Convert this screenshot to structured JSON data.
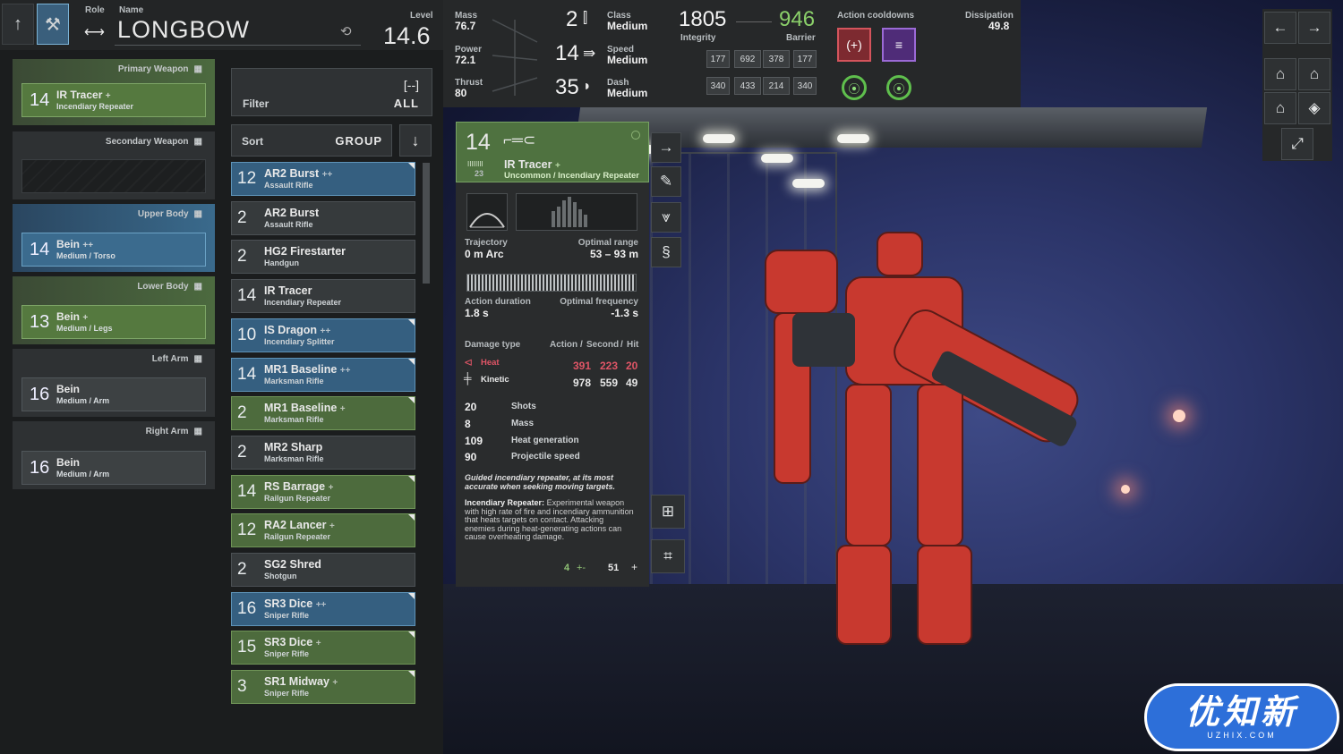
{
  "header": {
    "role_label": "Role",
    "name_label": "Name",
    "name": "LONGBOW",
    "level_label": "Level",
    "level": "14.6"
  },
  "stats": {
    "mass_label": "Mass",
    "mass": "76.7",
    "power_label": "Power",
    "power": "72.1",
    "thrust_label": "Thrust",
    "thrust": "80",
    "count1": "2",
    "count2": "14",
    "count3": "35",
    "class_label": "Class",
    "class_value": "Medium",
    "speed_label": "Speed",
    "speed_value": "Medium",
    "dash_label": "Dash",
    "dash_value": "Medium",
    "integrity": "1805",
    "integrity_label": "Integrity",
    "barrier": "946",
    "barrier_label": "Barrier",
    "cells_row1": [
      "177",
      "692",
      "378",
      "177"
    ],
    "cells_row2": [
      "340",
      "433",
      "214",
      "340"
    ],
    "cooldowns_label": "Action cooldowns",
    "dissipation_label": "Dissipation",
    "dissipation": "49.8"
  },
  "slots": [
    {
      "title": "Primary Weapon",
      "level": "14",
      "name": "IR Tracer",
      "plus": "+",
      "sub": "Incendiary Repeater",
      "color": "green"
    },
    {
      "title": "Secondary Weapon",
      "level": "",
      "name": "",
      "plus": "",
      "sub": "",
      "color": "empty"
    },
    {
      "title": "Upper Body",
      "level": "14",
      "name": "Bein",
      "plus": "++",
      "sub": "Medium / Torso",
      "color": "blue"
    },
    {
      "title": "Lower Body",
      "level": "13",
      "name": "Bein",
      "plus": "+",
      "sub": "Medium / Legs",
      "color": "green"
    },
    {
      "title": "Left Arm",
      "level": "16",
      "name": "Bein",
      "plus": "",
      "sub": "Medium / Arm",
      "color": "gray"
    },
    {
      "title": "Right Arm",
      "level": "16",
      "name": "Bein",
      "plus": "",
      "sub": "Medium / Arm",
      "color": "gray"
    }
  ],
  "filter": {
    "label": "Filter",
    "value": "ALL",
    "bracket": "[--]"
  },
  "sort": {
    "label": "Sort",
    "value": "GROUP"
  },
  "items": [
    {
      "level": "12",
      "name": "AR2 Burst",
      "plus": "++",
      "sub": "Assault Rifle",
      "color": "blue"
    },
    {
      "level": "2",
      "name": "AR2 Burst",
      "plus": "",
      "sub": "Assault Rifle",
      "color": "gray"
    },
    {
      "level": "2",
      "name": "HG2 Firestarter",
      "plus": "",
      "sub": "Handgun",
      "color": "gray"
    },
    {
      "level": "14",
      "name": "IR Tracer",
      "plus": "",
      "sub": "Incendiary Repeater",
      "color": "gray"
    },
    {
      "level": "10",
      "name": "IS Dragon",
      "plus": "++",
      "sub": "Incendiary Splitter",
      "color": "blue"
    },
    {
      "level": "14",
      "name": "MR1 Baseline",
      "plus": "++",
      "sub": "Marksman Rifle",
      "color": "blue"
    },
    {
      "level": "2",
      "name": "MR1 Baseline",
      "plus": "+",
      "sub": "Marksman Rifle",
      "color": "green"
    },
    {
      "level": "2",
      "name": "MR2 Sharp",
      "plus": "",
      "sub": "Marksman Rifle",
      "color": "gray"
    },
    {
      "level": "14",
      "name": "RS Barrage",
      "plus": "+",
      "sub": "Railgun Repeater",
      "color": "green"
    },
    {
      "level": "12",
      "name": "RA2 Lancer",
      "plus": "+",
      "sub": "Railgun Repeater",
      "color": "green"
    },
    {
      "level": "2",
      "name": "SG2 Shred",
      "plus": "",
      "sub": "Shotgun",
      "color": "gray"
    },
    {
      "level": "16",
      "name": "SR3 Dice",
      "plus": "++",
      "sub": "Sniper Rifle",
      "color": "blue"
    },
    {
      "level": "15",
      "name": "SR3 Dice",
      "plus": "+",
      "sub": "Sniper Rifle",
      "color": "green"
    },
    {
      "level": "3",
      "name": "SR1 Midway",
      "plus": "+",
      "sub": "Sniper Rifle",
      "color": "green"
    }
  ],
  "detail": {
    "level": "14",
    "ammo": "23",
    "name": "IR Tracer",
    "plus": "+",
    "sub": "Uncommon / Incendiary Repeater",
    "trajectory_label": "Trajectory",
    "trajectory": "0 m Arc",
    "range_label": "Optimal range",
    "range": "53 – 93 m",
    "duration_label": "Action duration",
    "duration": "1.8 s",
    "frequency_label": "Optimal frequency",
    "frequency": "-1.3 s",
    "damage_type_label": "Damage type",
    "action_label": "Action",
    "second_label": "Second",
    "hit_label": "Hit",
    "heat_label": "Heat",
    "heat": [
      "391",
      "223",
      "20"
    ],
    "kinetic_label": "Kinetic",
    "kinetic": [
      "978",
      "559",
      "49"
    ],
    "shots": "20",
    "shots_label": "Shots",
    "mass": "8",
    "mass_label": "Mass",
    "heatgen": "109",
    "heatgen_label": "Heat generation",
    "projspeed": "90",
    "projspeed_label": "Projectile speed",
    "flavor": "Guided incendiary repeater, at its most accurate when seeking moving targets.",
    "desc_title": "Incendiary Repeater:",
    "desc": "Experimental weapon with high rate of fire and incendiary ammunition that heats targets on contact. Attacking enemies during heat-generating actions can cause overheating damage.",
    "footer_left": "4",
    "footer_left_sym": "+-",
    "footer_right": "51",
    "footer_right_sym": "+"
  },
  "watermark": {
    "text": "优知新",
    "sub": "UZHIX.COM"
  },
  "colors": {
    "green": "#55793f",
    "blue": "#3b6b8e",
    "gray": "#3d4143",
    "heat": "#e05566",
    "cd1": "#8a2a2f",
    "cd2": "#5a2f86"
  }
}
